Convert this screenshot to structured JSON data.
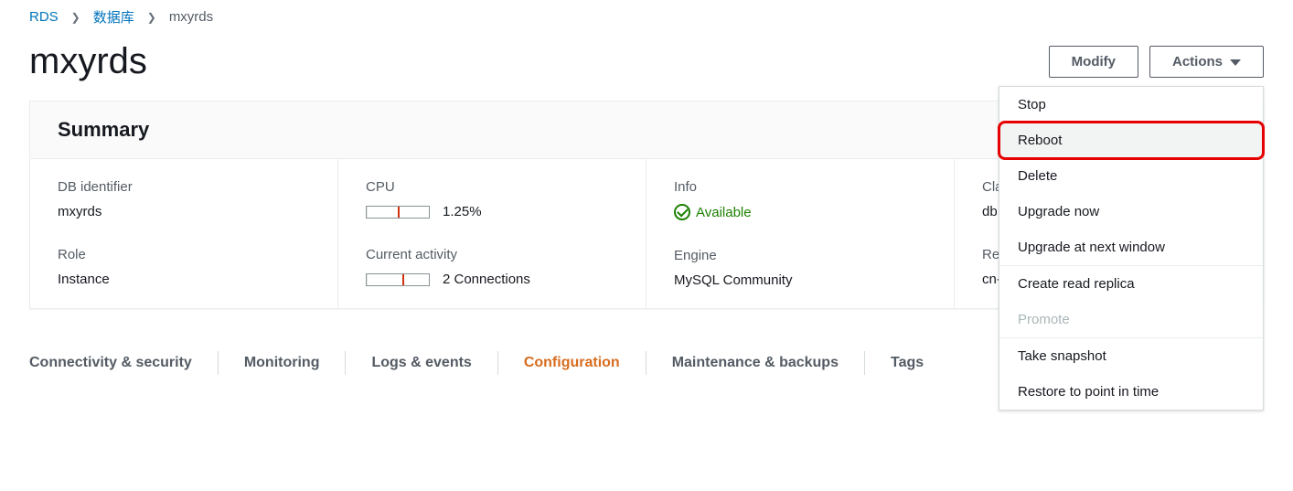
{
  "breadcrumb": {
    "root": "RDS",
    "databases": "数据库",
    "current": "mxyrds"
  },
  "page": {
    "title": "mxyrds"
  },
  "header_buttons": {
    "modify": "Modify",
    "actions": "Actions"
  },
  "actions_menu": {
    "stop": "Stop",
    "reboot": "Reboot",
    "delete": "Delete",
    "upgrade_now": "Upgrade now",
    "upgrade_next": "Upgrade at next window",
    "create_replica": "Create read replica",
    "promote": "Promote",
    "take_snapshot": "Take snapshot",
    "restore": "Restore to point in time"
  },
  "summary": {
    "title": "Summary",
    "db_identifier": {
      "label": "DB identifier",
      "value": "mxyrds"
    },
    "cpu": {
      "label": "CPU",
      "value": "1.25%",
      "fill_pct": 2,
      "tick_pct": 50
    },
    "info": {
      "label": "Info",
      "value": "Available"
    },
    "class": {
      "label": "Class",
      "value": "db.m"
    },
    "role": {
      "label": "Role",
      "value": "Instance"
    },
    "activity": {
      "label": "Current activity",
      "value": "2 Connections",
      "fill_pct": 2,
      "tick_pct": 57
    },
    "engine": {
      "label": "Engine",
      "value": "MySQL Community"
    },
    "region": {
      "label": "Region",
      "value": "cn-n"
    }
  },
  "tabs": {
    "connectivity": "Connectivity & security",
    "monitoring": "Monitoring",
    "logs": "Logs & events",
    "configuration": "Configuration",
    "maintenance": "Maintenance & backups",
    "tags": "Tags"
  }
}
